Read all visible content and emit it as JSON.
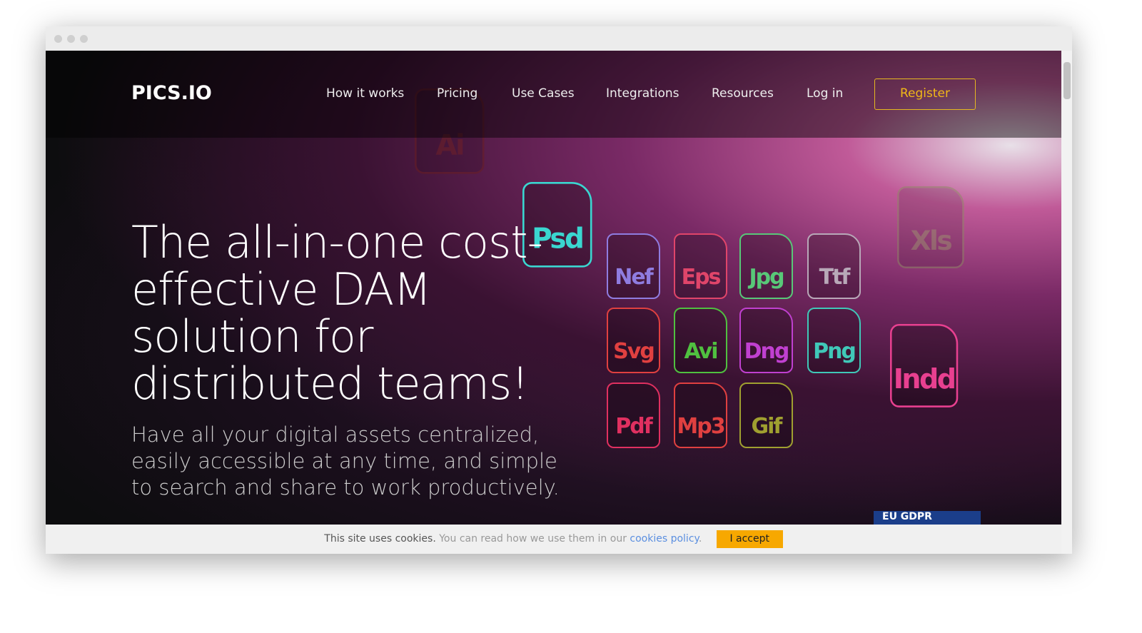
{
  "nav": {
    "logo": "PICS.IO",
    "items": [
      "How it works",
      "Pricing",
      "Use Cases",
      "Integrations",
      "Resources",
      "Log in"
    ],
    "register": "Register"
  },
  "hero": {
    "title": "The all-in-one cost-effective DAM solution for distributed teams!",
    "subtitle": "Have all your digital assets centralized, easily accessible at any time, and simple to search and share to work productively."
  },
  "file_icons": [
    {
      "label": "Ai",
      "color": "#6a1e1e"
    },
    {
      "label": "Psd",
      "color": "#3ad6d0"
    },
    {
      "label": "Nef",
      "color": "#8f7ce0"
    },
    {
      "label": "Eps",
      "color": "#e0456a"
    },
    {
      "label": "Jpg",
      "color": "#58c878"
    },
    {
      "label": "Ttf",
      "color": "#b8a8b8"
    },
    {
      "label": "Xls",
      "color": "#8a8a60"
    },
    {
      "label": "Svg",
      "color": "#e04040"
    },
    {
      "label": "Avi",
      "color": "#50c040"
    },
    {
      "label": "Dng",
      "color": "#c040d0"
    },
    {
      "label": "Png",
      "color": "#40c8b8"
    },
    {
      "label": "Indd",
      "color": "#e84090"
    },
    {
      "label": "Pdf",
      "color": "#e03060"
    },
    {
      "label": "Mp3",
      "color": "#e04040"
    },
    {
      "label": "Gif",
      "color": "#a0a030"
    }
  ],
  "gdpr": "EU GDPR",
  "cookie": {
    "text1": "This site uses cookies.",
    "text2": "You can read how we use them in our",
    "link": "cookies policy",
    "text3": ".",
    "accept": "I accept"
  }
}
